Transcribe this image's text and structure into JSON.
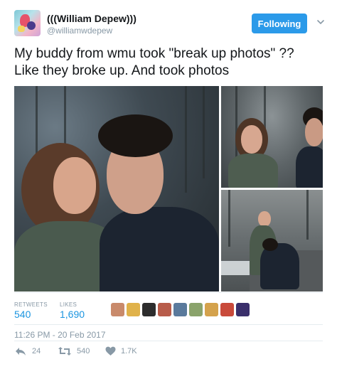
{
  "author": {
    "name": "(((William Depew)))",
    "handle": "@williamwdepew"
  },
  "follow_button": {
    "label": "Following"
  },
  "tweet": {
    "text": "My buddy from wmu took \"break up photos\" ??\nLike they broke up. And took photos"
  },
  "stats": {
    "retweets_label": "RETWEETS",
    "retweets": "540",
    "likes_label": "LIKES",
    "likes": "1,690"
  },
  "likers": [
    {
      "color": "#c98a6b"
    },
    {
      "color": "#e0b24a"
    },
    {
      "color": "#2d2d2d"
    },
    {
      "color": "#b85c4a"
    },
    {
      "color": "#5a7a9c"
    },
    {
      "color": "#8aa36b"
    },
    {
      "color": "#d4a24c"
    },
    {
      "color": "#c94a3a"
    },
    {
      "color": "#3a2f6b"
    }
  ],
  "timestamp": "11:26 PM - 20 Feb 2017",
  "actions": {
    "reply_count": "24",
    "retweet_count": "540",
    "like_count": "1.7K"
  }
}
